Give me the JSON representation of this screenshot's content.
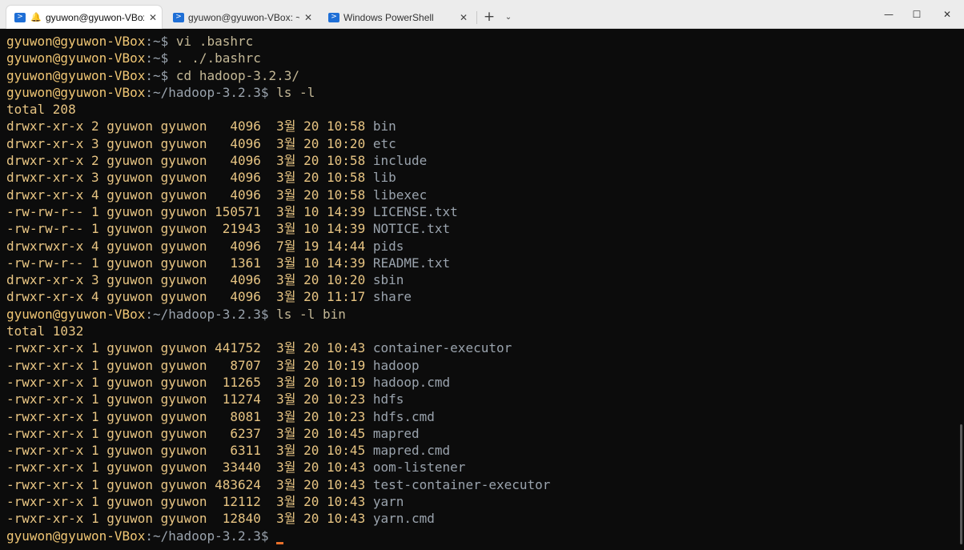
{
  "tabs": [
    {
      "label": "gyuwon@gyuwon-VBox:",
      "active": true,
      "has_bell": true
    },
    {
      "label": "gyuwon@gyuwon-VBox: ~/ha",
      "active": false,
      "has_bell": false
    },
    {
      "label": "Windows PowerShell",
      "active": false,
      "has_bell": false
    }
  ],
  "tab_icon": "powershell-icon",
  "new_tab": "+",
  "dropdown": "⌄",
  "window_controls": {
    "minimize": "—",
    "maximize": "☐",
    "close": "✕"
  },
  "terminal": {
    "lines": [
      {
        "user": "gyuwon@gyuwon-VBox",
        "path": ":~",
        "prompt": "$ ",
        "cmd": "vi .bashrc"
      },
      {
        "user": "gyuwon@gyuwon-VBox",
        "path": ":~",
        "prompt": "$ ",
        "cmd": ". ./.bashrc"
      },
      {
        "user": "gyuwon@gyuwon-VBox",
        "path": ":~",
        "prompt": "$ ",
        "cmd": "cd hadoop-3.2.3/"
      },
      {
        "user": "gyuwon@gyuwon-VBox",
        "path": ":~/hadoop-3.2.3",
        "prompt": "$ ",
        "cmd": "ls -l"
      },
      {
        "out": "total 208"
      },
      {
        "out": "drwxr-xr-x 2 gyuwon gyuwon   4096  3월 20 10:58 ",
        "name": "bin"
      },
      {
        "out": "drwxr-xr-x 3 gyuwon gyuwon   4096  3월 20 10:20 ",
        "name": "etc"
      },
      {
        "out": "drwxr-xr-x 2 gyuwon gyuwon   4096  3월 20 10:58 ",
        "name": "include"
      },
      {
        "out": "drwxr-xr-x 3 gyuwon gyuwon   4096  3월 20 10:58 ",
        "name": "lib"
      },
      {
        "out": "drwxr-xr-x 4 gyuwon gyuwon   4096  3월 20 10:58 ",
        "name": "libexec"
      },
      {
        "out": "-rw-rw-r-- 1 gyuwon gyuwon 150571  3월 10 14:39 ",
        "name": "LICENSE.txt"
      },
      {
        "out": "-rw-rw-r-- 1 gyuwon gyuwon  21943  3월 10 14:39 ",
        "name": "NOTICE.txt"
      },
      {
        "out": "drwxrwxr-x 4 gyuwon gyuwon   4096  7월 19 14:44 ",
        "name": "pids"
      },
      {
        "out": "-rw-rw-r-- 1 gyuwon gyuwon   1361  3월 10 14:39 ",
        "name": "README.txt"
      },
      {
        "out": "drwxr-xr-x 3 gyuwon gyuwon   4096  3월 20 10:20 ",
        "name": "sbin"
      },
      {
        "out": "drwxr-xr-x 4 gyuwon gyuwon   4096  3월 20 11:17 ",
        "name": "share"
      },
      {
        "user": "gyuwon@gyuwon-VBox",
        "path": ":~/hadoop-3.2.3",
        "prompt": "$ ",
        "cmd": "ls -l bin"
      },
      {
        "out": "total 1032"
      },
      {
        "out": "-rwxr-xr-x 1 gyuwon gyuwon 441752  3월 20 10:43 ",
        "name": "container-executor"
      },
      {
        "out": "-rwxr-xr-x 1 gyuwon gyuwon   8707  3월 20 10:19 ",
        "name": "hadoop"
      },
      {
        "out": "-rwxr-xr-x 1 gyuwon gyuwon  11265  3월 20 10:19 ",
        "name": "hadoop.cmd"
      },
      {
        "out": "-rwxr-xr-x 1 gyuwon gyuwon  11274  3월 20 10:23 ",
        "name": "hdfs"
      },
      {
        "out": "-rwxr-xr-x 1 gyuwon gyuwon   8081  3월 20 10:23 ",
        "name": "hdfs.cmd"
      },
      {
        "out": "-rwxr-xr-x 1 gyuwon gyuwon   6237  3월 20 10:45 ",
        "name": "mapred"
      },
      {
        "out": "-rwxr-xr-x 1 gyuwon gyuwon   6311  3월 20 10:45 ",
        "name": "mapred.cmd"
      },
      {
        "out": "-rwxr-xr-x 1 gyuwon gyuwon  33440  3월 20 10:43 ",
        "name": "oom-listener"
      },
      {
        "out": "-rwxr-xr-x 1 gyuwon gyuwon 483624  3월 20 10:43 ",
        "name": "test-container-executor"
      },
      {
        "out": "-rwxr-xr-x 1 gyuwon gyuwon  12112  3월 20 10:43 ",
        "name": "yarn"
      },
      {
        "out": "-rwxr-xr-x 1 gyuwon gyuwon  12840  3월 20 10:43 ",
        "name": "yarn.cmd"
      },
      {
        "user": "gyuwon@gyuwon-VBox",
        "path": ":~/hadoop-3.2.3",
        "prompt": "$ ",
        "cmd": "",
        "cursor": true
      }
    ]
  }
}
